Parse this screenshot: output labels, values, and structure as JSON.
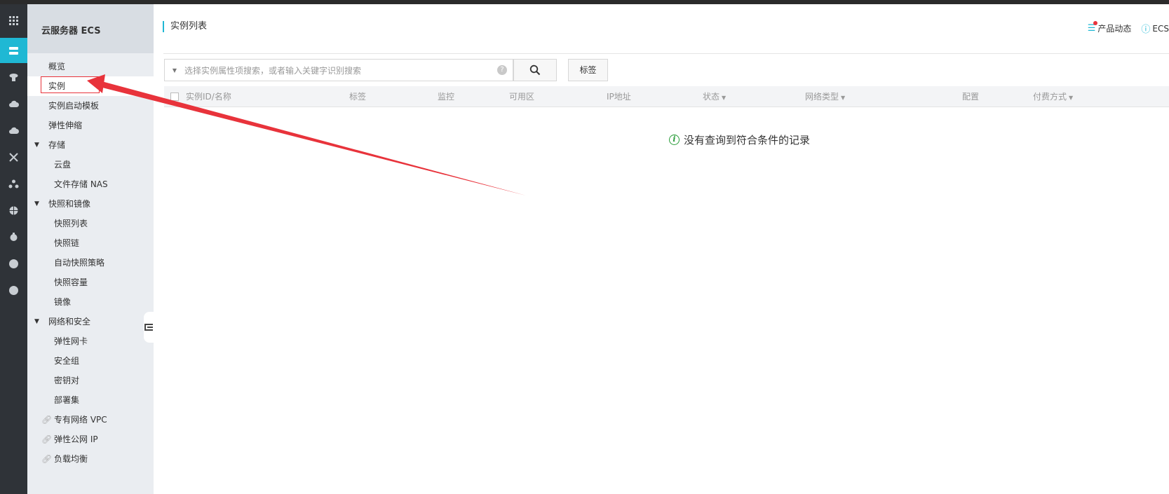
{
  "sidebar": {
    "title": "云服务器 ECS",
    "items": [
      {
        "label": "概览"
      },
      {
        "label": "实例"
      },
      {
        "label": "实例启动模板"
      },
      {
        "label": "弹性伸缩"
      },
      {
        "label": "存储"
      },
      {
        "label": "云盘"
      },
      {
        "label": "文件存储 NAS"
      },
      {
        "label": "快照和镜像"
      },
      {
        "label": "快照列表"
      },
      {
        "label": "快照链"
      },
      {
        "label": "自动快照策略"
      },
      {
        "label": "快照容量"
      },
      {
        "label": "镜像"
      },
      {
        "label": "网络和安全"
      },
      {
        "label": "弹性网卡"
      },
      {
        "label": "安全组"
      },
      {
        "label": "密钥对"
      },
      {
        "label": "部署集"
      },
      {
        "label": "专有网络 VPC"
      },
      {
        "label": "弹性公网 IP"
      },
      {
        "label": "负载均衡"
      }
    ]
  },
  "header": {
    "title": "实例列表",
    "product_news": "产品动态",
    "help_label": "ECS"
  },
  "search": {
    "placeholder": "选择实例属性项搜索，或者输入关键字识别搜索"
  },
  "toolbar": {
    "tag_label": "标签"
  },
  "table": {
    "columns": [
      "实例ID/名称",
      "标签",
      "监控",
      "可用区",
      "IP地址",
      "状态",
      "网络类型",
      "配置",
      "付费方式"
    ],
    "empty_text": "没有查询到符合条件的记录"
  },
  "colors": {
    "accent": "#1fb8d4",
    "annotation": "#e8333b",
    "success": "#2a9d3a"
  }
}
